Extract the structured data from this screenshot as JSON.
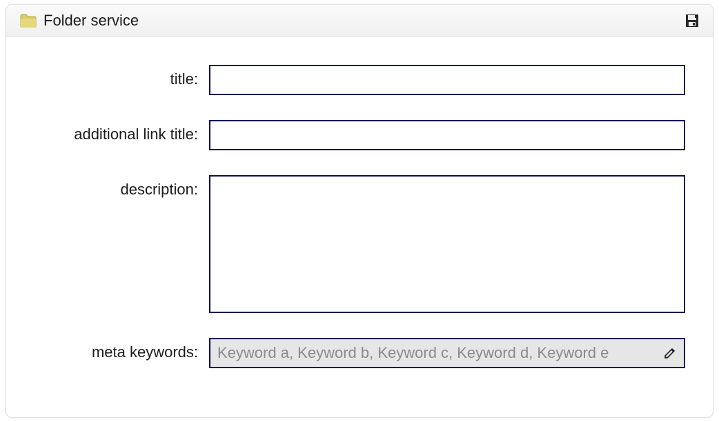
{
  "header": {
    "title": "Folder service"
  },
  "form": {
    "title_label": "title:",
    "title_value": "",
    "linktitle_label": "additional link title:",
    "linktitle_value": "",
    "description_label": "description:",
    "description_value": "",
    "keywords_label": "meta keywords:",
    "keywords_value": "",
    "keywords_placeholder": "Keyword a, Keyword b, Keyword c, Keyword d, Keyword e"
  },
  "icons": {
    "folder": "folder-icon",
    "save": "save-icon",
    "edit": "pencil-icon"
  }
}
